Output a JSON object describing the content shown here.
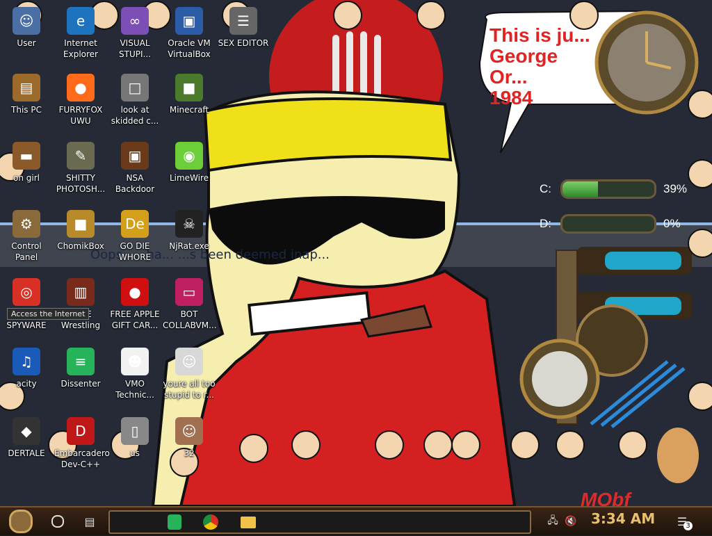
{
  "desktop_icons": [
    {
      "label": "User",
      "icon": "user-folder-icon",
      "color": "#4a6fa5"
    },
    {
      "label": "Internet Explorer",
      "icon": "internet-explorer-icon",
      "color": "#1e73be"
    },
    {
      "label": "VISUAL STUPI...",
      "icon": "visual-studio-icon",
      "color": "#7b4fb6"
    },
    {
      "label": "Oracle VM VirtualBox",
      "icon": "virtualbox-icon",
      "color": "#2a5ca8"
    },
    {
      "label": "SEX EDITOR",
      "icon": "hex-editor-icon",
      "color": "#666666"
    },
    {
      "label": "This PC",
      "icon": "computer-icon",
      "color": "#9c6a2a"
    },
    {
      "label": "FURRYFOX UWU",
      "icon": "firefox-icon",
      "color": "#ff6b1a"
    },
    {
      "label": "look at skidded c...",
      "icon": "copy-icon",
      "color": "#777777"
    },
    {
      "label": "Minecraft",
      "icon": "minecraft-icon",
      "color": "#4c7a2d"
    },
    {
      "label": "on girl",
      "icon": "folder-icon",
      "color": "#8a5a2a"
    },
    {
      "label": "SHITTY PHOTOSH...",
      "icon": "gimp-icon",
      "color": "#6a6a50"
    },
    {
      "label": "NSA Backdoor",
      "icon": "safe-icon",
      "color": "#6a3a1a"
    },
    {
      "label": "LimeWire",
      "icon": "limewire-icon",
      "color": "#6ccf3a"
    },
    {
      "label": "Control Panel",
      "icon": "control-panel-icon",
      "color": "#8a6a3a"
    },
    {
      "label": "ChomikBox",
      "icon": "chomikbox-icon",
      "color": "#b88a2a"
    },
    {
      "label": "GO DIE WHORE",
      "icon": "de-app-icon",
      "color": "#d4a01a"
    },
    {
      "label": "NjRat.exe",
      "icon": "skull-icon",
      "color": "#222222"
    },
    {
      "label": "THIS IS SPYWARE",
      "icon": "chrome-icon",
      "color": "#d93025"
    },
    {
      "label": "WWE Wrestling",
      "icon": "wwe-icon",
      "color": "#7a2a1a"
    },
    {
      "label": "FREE APPLE GIFT CAR...",
      "icon": "apple-icon",
      "color": "#d01010"
    },
    {
      "label": "BOT COLLABVM...",
      "icon": "monitor-icon",
      "color": "#c02060"
    },
    {
      "label": "acity",
      "icon": "audacity-icon",
      "color": "#1a5ab8"
    },
    {
      "label": "Dissenter",
      "icon": "dissenter-icon",
      "color": "#27b35a"
    },
    {
      "label": "VMO Technic...",
      "icon": "technician-icon",
      "color": "#f2f2f2"
    },
    {
      "label": "youre all too stupid to r...",
      "icon": "portrait-icon",
      "color": "#d8d8d8"
    },
    {
      "label": "DERTALE",
      "icon": "unity-icon",
      "color": "#333333"
    },
    {
      "label": "Embarcadero Dev-C++",
      "icon": "devcpp-icon",
      "color": "#c01818"
    },
    {
      "label": "us",
      "icon": "generic-file-icon",
      "color": "#888888"
    },
    {
      "label": "32",
      "icon": "portrait-woman-icon",
      "color": "#a07050"
    }
  ],
  "tooltip": "Access the Internet",
  "speech_bubble": {
    "lines": [
      "This is ju...",
      "George Or...",
      "1984"
    ]
  },
  "dialog_text": "Oops, ... ha... ...s been deemed inap...",
  "disks": [
    {
      "letter": "C:",
      "percent": 39,
      "label": "39%"
    },
    {
      "letter": "D:",
      "percent": 0,
      "label": "0%"
    }
  ],
  "wallpaper_watermark": "MObf",
  "taskbar": {
    "start_icon": "steampunk-gear-icon",
    "search_icon": "cortana-circle-icon",
    "taskview_icon": "task-view-icon",
    "pinned": [
      {
        "name": "dissenter",
        "icon": "dissenter-icon",
        "color": "#27b35a"
      },
      {
        "name": "chrome",
        "icon": "chrome-icon",
        "color": "#d93025"
      },
      {
        "name": "file-explorer",
        "icon": "folder-icon",
        "color": "#f2c14a"
      }
    ],
    "tray": {
      "network_icon": "network-icon",
      "volume_icon": "volume-muted-icon"
    },
    "clock": "3:34 AM",
    "notification_count": "3"
  },
  "colors": {
    "bubble_text": "#e32222",
    "clock_text": "#e8c070",
    "taskbar_bg": "#2a1a0e"
  }
}
